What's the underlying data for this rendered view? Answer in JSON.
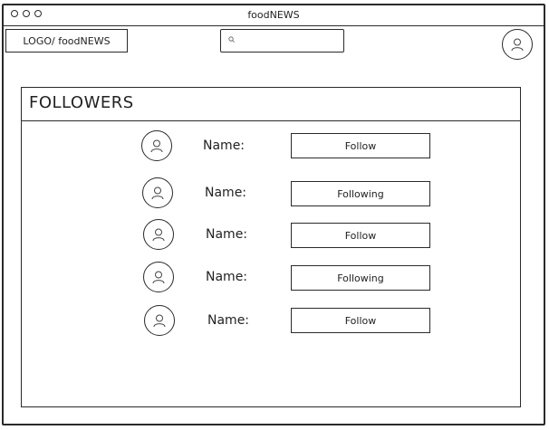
{
  "window": {
    "title": "foodNEWS"
  },
  "header": {
    "logo_text": "LOGO/ foodNEWS",
    "search": {
      "value": "",
      "icon": "search-icon"
    },
    "profile_icon": "user-icon"
  },
  "panel": {
    "title": "FOLLOWERS",
    "rows": [
      {
        "name_label": "Name:",
        "button_label": "Follow"
      },
      {
        "name_label": "Name:",
        "button_label": "Following"
      },
      {
        "name_label": "Name:",
        "button_label": "Follow"
      },
      {
        "name_label": "Name:",
        "button_label": "Following"
      },
      {
        "name_label": "Name:",
        "button_label": "Follow"
      }
    ]
  }
}
